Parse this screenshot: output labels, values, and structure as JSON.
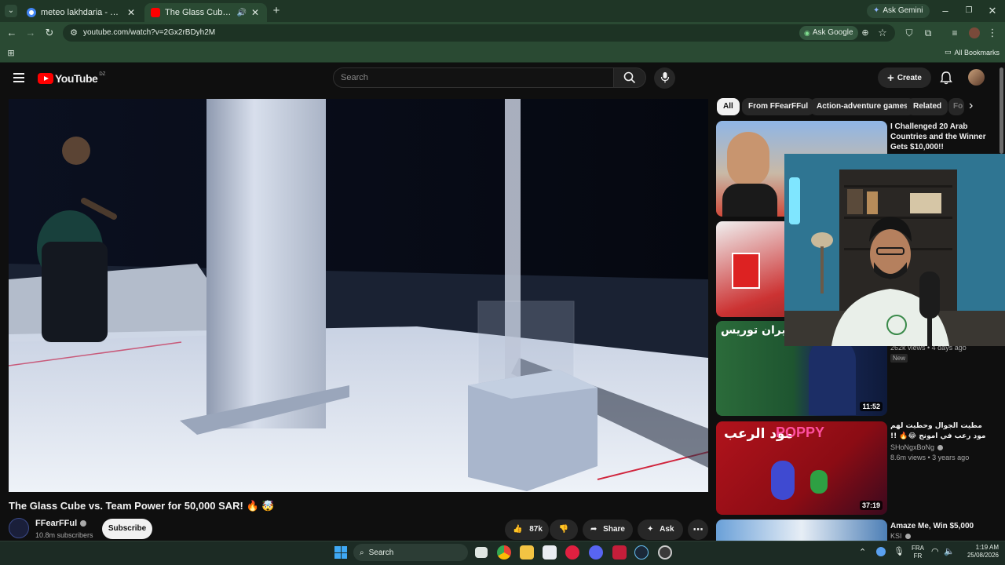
{
  "browser": {
    "tabs": [
      {
        "title": "meteo lakhdaria - Recherche Go",
        "active": false
      },
      {
        "title": "The Glass Cube vs. Team Po",
        "active": true
      }
    ],
    "new_tab": "+",
    "gemini_label": "Ask Gemini",
    "url": "youtube.com/watch?v=2Gx2rBDyh2M",
    "ask_google_label": "Ask Google",
    "all_bookmarks_label": "All Bookmarks"
  },
  "youtube": {
    "logo_text": "YouTube",
    "country_code": "DZ",
    "search_placeholder": "Search",
    "create_label": "Create"
  },
  "filters": [
    "All",
    "From FFearFFul",
    "Action-adventure games",
    "Related",
    "Fo"
  ],
  "video": {
    "title": "The Glass Cube vs. Team Power for 50,000 SAR! 🔥 🤯",
    "channel_name": "FFearFFul",
    "subscribers": "10.8m subscribers",
    "subscribe_label": "Subscribe",
    "likes": "87k",
    "share_label": "Share",
    "ask_label": "Ask"
  },
  "recommendations": [
    {
      "title": "I Challenged 20 Arab Countries and the Winner Gets $10,000!!",
      "meta": "",
      "duration": "",
      "badge": ""
    },
    {
      "title": "",
      "meta": "",
      "duration": "",
      "badge": ""
    },
    {
      "title": "",
      "meta": "262k views • 4 days ago",
      "duration": "11:52",
      "badge": "New",
      "thumb_text_ar": "لأسطورة نيران توريس"
    },
    {
      "title": "مطيت الجوال وحطيت لهم مود رعب في امونج 😂🔥 !!",
      "channel": "SHoNgxBoNg",
      "meta": "8.6m views • 3 years ago",
      "duration": "37:19",
      "badge": "",
      "thumb_text_ar": "مود الرعب",
      "thumb_text_en": "POPPY"
    },
    {
      "title": "Amaze Me, Win $5,000",
      "channel": "KSI",
      "meta": "",
      "duration": "",
      "badge": ""
    }
  ],
  "taskbar": {
    "search_label": "Search",
    "language": "FRA",
    "language_sub": "FR",
    "time": "1:19 AM",
    "date": "25/08/2026"
  },
  "colors": {
    "youtube_red": "#ff0000",
    "chrome_tab_bg": "#1f3626",
    "chrome_toolbar_bg": "#2a4a33",
    "youtube_bg": "#0f0f0f"
  }
}
